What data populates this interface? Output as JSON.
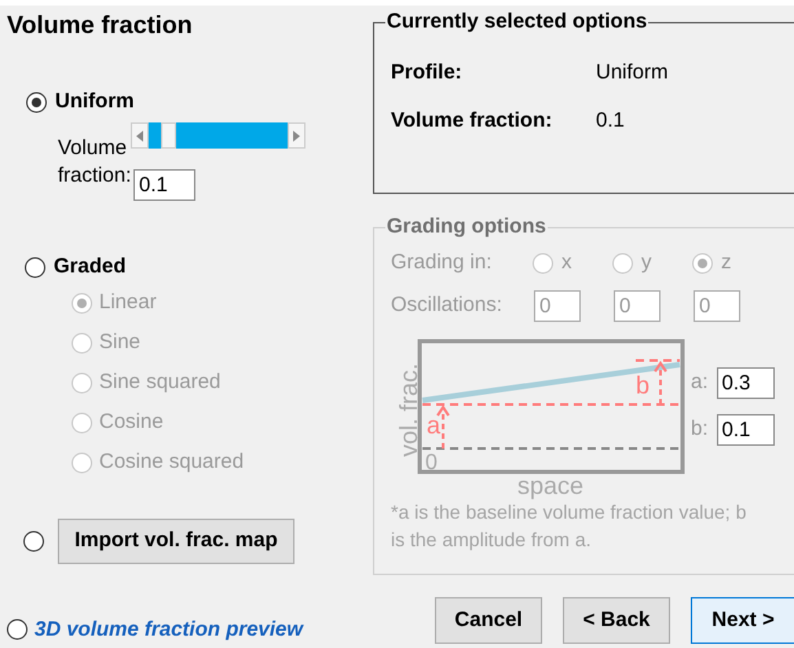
{
  "title": "Volume fraction",
  "uniform": {
    "label": "Uniform",
    "selected": true,
    "field_label": "Volume fraction:",
    "level": 0.1,
    "value": "0.1"
  },
  "graded": {
    "label": "Graded",
    "selected": false,
    "disabled": true,
    "shapes": [
      {
        "label": "Linear",
        "selected": true
      },
      {
        "label": "Sine",
        "selected": false
      },
      {
        "label": "Sine squared",
        "selected": false
      },
      {
        "label": "Cosine",
        "selected": false
      },
      {
        "label": "Cosine squared",
        "selected": false
      }
    ]
  },
  "import": {
    "selected": false,
    "button": "Import vol. frac. map"
  },
  "preview": {
    "label": "3D volume fraction preview",
    "selected": false
  },
  "summary": {
    "title": "Currently selected options",
    "rows": [
      {
        "label": "Profile:",
        "value": "Uniform"
      },
      {
        "label": "Volume fraction:",
        "value": "0.1"
      }
    ]
  },
  "grading": {
    "title": "Grading options",
    "disabled": true,
    "direction_label": "Grading in:",
    "directions": [
      {
        "label": "x",
        "selected": false
      },
      {
        "label": "y",
        "selected": false
      },
      {
        "label": "z",
        "selected": true
      }
    ],
    "oscillations_label": "Oscillations:",
    "oscillations": [
      "0",
      "0",
      "0"
    ],
    "y_label": "vol. frac.",
    "x_label": "space",
    "zero": "0",
    "a_marker": "a",
    "b_marker": "b",
    "params": [
      {
        "label": "a:",
        "value": "0.3"
      },
      {
        "label": "b:",
        "value": "0.1"
      }
    ],
    "note": "*a is the baseline volume fraction value; b is the amplitude from a."
  },
  "buttons": [
    {
      "label": "Cancel",
      "primary": false
    },
    {
      "label": "< Back",
      "primary": false
    },
    {
      "label": "Next >",
      "primary": true
    }
  ]
}
